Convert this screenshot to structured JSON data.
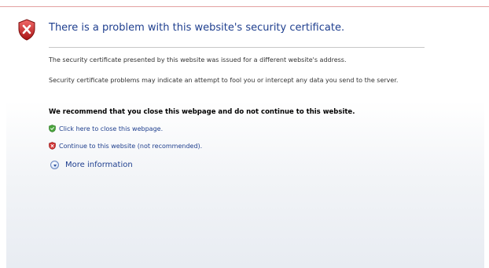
{
  "header": {
    "title": "There is a problem with this website's security certificate."
  },
  "body": {
    "paragraph_1": "The security certificate presented by this website was issued for a different website's address.",
    "paragraph_2": "Security certificate problems may indicate an attempt to fool you or intercept any data you send to the server.",
    "recommendation": "We recommend that you close this webpage and do not continue to this website."
  },
  "links": {
    "close_label": "Click here to close this webpage.",
    "continue_label": "Continue to this website (not recommended).",
    "more_info_label": "More information"
  },
  "icons": {
    "header_icon": "shield-error-icon",
    "close_icon": "green-shield-icon",
    "continue_icon": "red-shield-icon",
    "more_icon": "expand-circle-icon"
  },
  "colors": {
    "title": "#1f3f8f",
    "link": "#1e3e8d",
    "error_red": "#c62828",
    "ok_green": "#3a9b35"
  }
}
